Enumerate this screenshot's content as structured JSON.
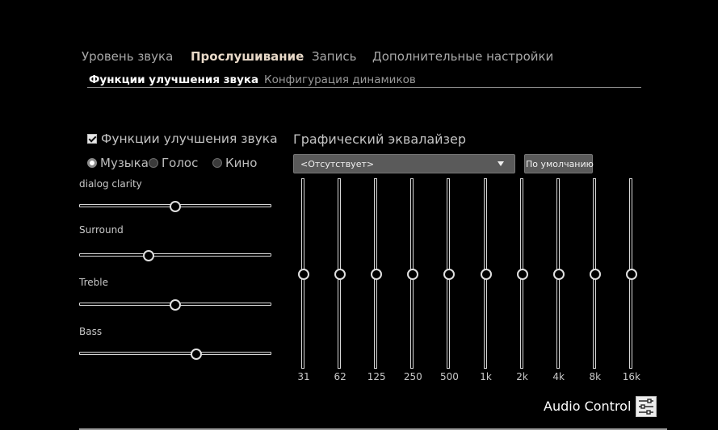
{
  "tabs": [
    {
      "label": "Уровень звука",
      "active": false
    },
    {
      "label": "Прослушивание",
      "active": true
    },
    {
      "label": "Запись",
      "active": false
    },
    {
      "label": "Дополнительные настройки",
      "active": false
    }
  ],
  "subtabs": [
    {
      "label": "Функции улучшения звука",
      "active": true
    },
    {
      "label": "Конфигурация динамиков",
      "active": false
    }
  ],
  "enhancements": {
    "checkbox_label": "Функции улучшения звука",
    "checked": true,
    "modes": [
      {
        "label": "Музыка",
        "selected": true
      },
      {
        "label": "Голос",
        "selected": false
      },
      {
        "label": "Кино",
        "selected": false
      }
    ],
    "sliders": [
      {
        "label": "dialog clarity",
        "value": 0.5
      },
      {
        "label": "Surround",
        "value": 0.36
      },
      {
        "label": "Treble",
        "value": 0.5
      },
      {
        "label": "Bass",
        "value": 0.61
      }
    ]
  },
  "equalizer": {
    "title": "Графический эквалайзер",
    "preset": "<Отсутствует>",
    "default_button": "По умолчанию",
    "bands": [
      {
        "freq": "31",
        "level": 0.5
      },
      {
        "freq": "62",
        "level": 0.5
      },
      {
        "freq": "125",
        "level": 0.5
      },
      {
        "freq": "250",
        "level": 0.5
      },
      {
        "freq": "500",
        "level": 0.5
      },
      {
        "freq": "1k",
        "level": 0.5
      },
      {
        "freq": "2k",
        "level": 0.5
      },
      {
        "freq": "4k",
        "level": 0.5
      },
      {
        "freq": "8k",
        "level": 0.5
      },
      {
        "freq": "16k",
        "level": 0.5
      }
    ]
  },
  "brand": {
    "label": "Audio Control",
    "icon": "sliders-icon"
  }
}
